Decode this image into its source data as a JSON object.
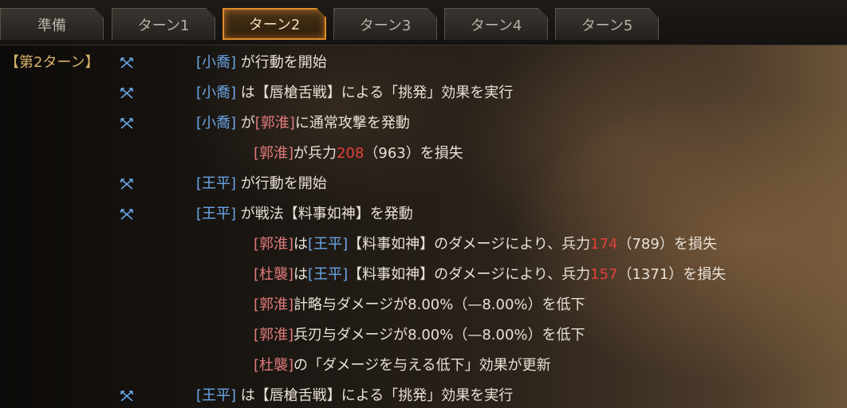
{
  "tabs": [
    {
      "label": "準備",
      "active": false
    },
    {
      "label": "ターン1",
      "active": false
    },
    {
      "label": "ターン2",
      "active": true
    },
    {
      "label": "ターン3",
      "active": false
    },
    {
      "label": "ターン4",
      "active": false
    },
    {
      "label": "ターン5",
      "active": false
    }
  ],
  "turn_label": "【第2ターン】",
  "colors": {
    "ally": "#6aa7e8",
    "enemy": "#e07b7b",
    "damage": "#e2403a",
    "accent": "#e08a2a"
  },
  "icon_name": "crossed-swords-icon",
  "rows": [
    {
      "r1": "[小喬]",
      "t1": " が行動を開始"
    },
    {
      "r1": "[小喬]",
      "t1": " は【唇槍舌戦】による「挑発」効果を実行"
    },
    {
      "r1": "[小喬]",
      "t1": " が",
      "e1": "[郭淮]",
      "t2": "に通常攻撃を発動"
    },
    {
      "e1": "[郭淮]",
      "t1": "が兵力",
      "n1": "208",
      "t2": "（963）を損失"
    },
    {
      "r1": "[王平]",
      "t1": " が行動を開始"
    },
    {
      "r1": "[王平]",
      "t1": " が戦法【料事如神】を発動"
    },
    {
      "e1": "[郭淮]",
      "t1": "は",
      "r1": "[王平]",
      "t2": "【料事如神】のダメージにより、兵力",
      "n1": "174",
      "t3": "（789）を損失"
    },
    {
      "e1": "[杜襲]",
      "t1": "は",
      "r1": "[王平]",
      "t2": "【料事如神】のダメージにより、兵力",
      "n1": "157",
      "t3": "（1371）を損失"
    },
    {
      "e1": "[郭淮]",
      "t1": "計略与ダメージが8.00%（—8.00%）を低下"
    },
    {
      "e1": "[郭淮]",
      "t1": "兵刃与ダメージが8.00%（—8.00%）を低下"
    },
    {
      "e1": "[杜襲]",
      "t1": "の「ダメージを与える低下」効果が更新"
    },
    {
      "r1": "[王平]",
      "t1": " は【唇槍舌戦】による「挑発」効果を実行"
    }
  ]
}
